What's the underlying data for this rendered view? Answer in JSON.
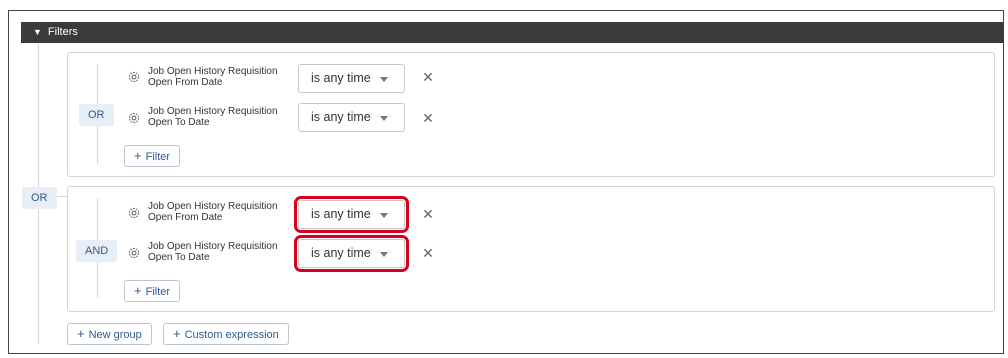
{
  "header": {
    "title": "Filters"
  },
  "outer_operator": "OR",
  "groups": [
    {
      "operator": "OR",
      "rows": [
        {
          "label_line1": "Job Open History Requisition",
          "label_line2": "Open From Date",
          "value": "is any time"
        },
        {
          "label_line1": "Job Open History Requisition",
          "label_line2": "Open To Date",
          "value": "is any time"
        }
      ],
      "add_filter_label": "Filter"
    },
    {
      "operator": "AND",
      "rows": [
        {
          "label_line1": "Job Open History Requisition",
          "label_line2": "Open From Date",
          "value": "is any time"
        },
        {
          "label_line1": "Job Open History Requisition",
          "label_line2": "Open To Date",
          "value": "is any time"
        }
      ],
      "add_filter_label": "Filter"
    }
  ],
  "footer": {
    "new_group_label": "New group",
    "custom_expression_label": "Custom expression"
  },
  "icons": {
    "remove": "close-icon",
    "field": "gear-icon",
    "add": "plus-icon",
    "collapse": "caret-down-icon"
  },
  "colors": {
    "header_bg": "#3b3b3b",
    "accent": "#2f5b8f",
    "highlight": "#d6001c"
  }
}
